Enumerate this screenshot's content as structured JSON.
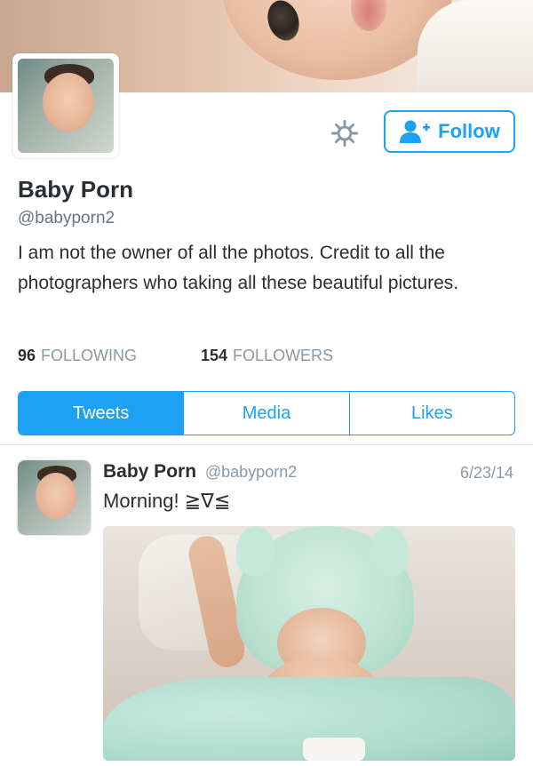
{
  "profile": {
    "name": "Baby Porn",
    "handle": "@babyporn2",
    "bio": "I am not the owner of all the photos. Credit to all the photographers who taking all these beautiful pictures.",
    "follow_label": "Follow",
    "follow_icon": "add-user-icon",
    "settings_icon": "gear-icon",
    "following_count": "96",
    "following_label": "FOLLOWING",
    "followers_count": "154",
    "followers_label": "FOLLOWERS"
  },
  "tabs": [
    {
      "label": "Tweets",
      "active": true
    },
    {
      "label": "Media",
      "active": false
    },
    {
      "label": "Likes",
      "active": false
    }
  ],
  "tweet": {
    "name": "Baby Porn",
    "handle": "@babyporn2",
    "date": "6/23/14",
    "text": "Morning! ≧∇≦"
  },
  "colors": {
    "accent": "#1da1f2",
    "text_primary": "#292f33",
    "text_secondary": "#8899a6"
  }
}
